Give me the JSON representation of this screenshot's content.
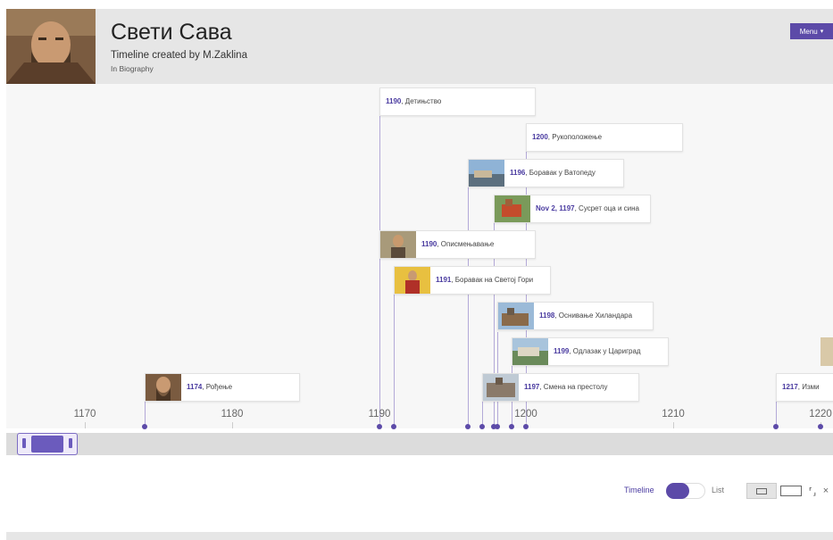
{
  "header": {
    "title": "Свети Сава",
    "subtitle": "Timeline created by M.Zaklina",
    "category": "In Biography",
    "menu_label": "Menu",
    "menu_caret": "▾"
  },
  "events": [
    {
      "date": "1190",
      "text": ", Детињство"
    },
    {
      "date": "1200",
      "text": ", Рукоположење"
    },
    {
      "date": "1196",
      "text": ", Боравак у Ватопеду"
    },
    {
      "date": "Nov 2, 1197",
      "text": ", Сусрет оца и сина"
    },
    {
      "date": "1190",
      "text": ", Описмењавање"
    },
    {
      "date": "1191",
      "text": ", Боравак на Светој Гори"
    },
    {
      "date": "1198",
      "text": ", Оснивање Хиландара"
    },
    {
      "date": "1199",
      "text": ", Одлазак у Цариград"
    },
    {
      "date": "1174",
      "text": ", Рођење"
    },
    {
      "date": "1197",
      "text": ", Смена на престолу"
    },
    {
      "date": "1217",
      "text": ", Изми"
    }
  ],
  "axis": {
    "ticks": [
      "1170",
      "1180",
      "1190",
      "1200",
      "1210",
      "1220"
    ]
  },
  "controls": {
    "timeline_label": "Timeline",
    "list_label": "List",
    "view_mode": "timeline"
  }
}
